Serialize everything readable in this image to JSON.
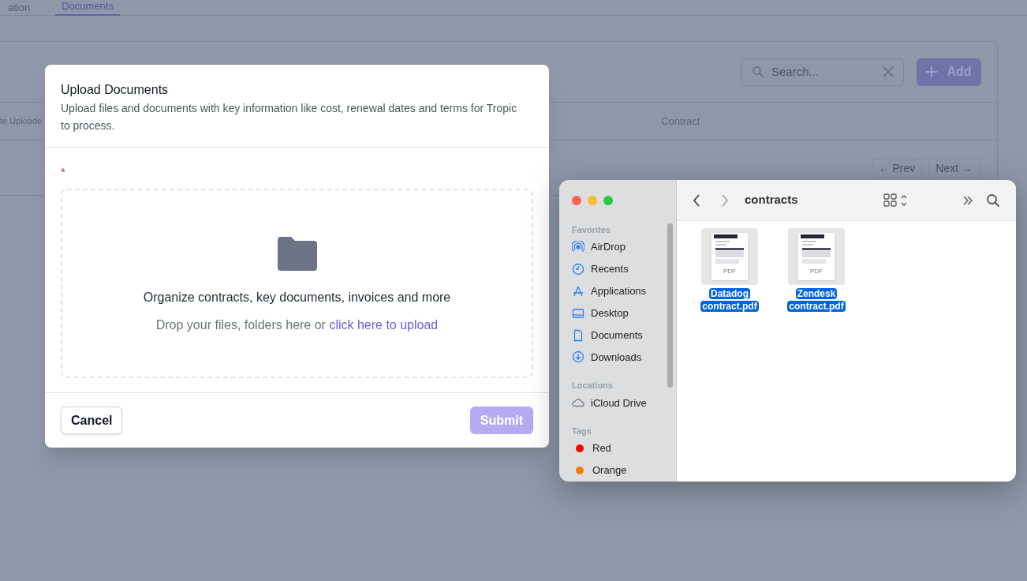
{
  "background": {
    "tabs": [
      {
        "label": "ation",
        "selected": false
      },
      {
        "label": "Documents",
        "selected": true
      }
    ],
    "search": {
      "placeholder": "Search..."
    },
    "add_button": "Add",
    "table": {
      "columns": [
        "te Uploade",
        "Contract"
      ]
    },
    "pagination": [
      "← Prev",
      "Next →"
    ]
  },
  "modal": {
    "title": "Upload Documents",
    "description": "Upload files and documents with key information like cost, renewal dates and terms for Tropic to process.",
    "required_mark": "*",
    "dropzone": {
      "heading": "Organize contracts, key documents, invoices and more",
      "hint": "Drop your files, folders here or",
      "link": "click here to upload"
    },
    "buttons": [
      {
        "label": "Cancel",
        "kind": "secondary",
        "disabled": false
      },
      {
        "label": "Submit",
        "kind": "primary",
        "disabled": true
      }
    ]
  },
  "finder": {
    "title": "contracts",
    "sidebar": [
      {
        "heading": "Favorites",
        "items": [
          {
            "label": "AirDrop",
            "kind": "airdrop"
          },
          {
            "label": "Recents",
            "kind": "clock"
          },
          {
            "label": "Applications",
            "kind": "apps"
          },
          {
            "label": "Desktop",
            "kind": "desktop"
          },
          {
            "label": "Documents",
            "kind": "document"
          },
          {
            "label": "Downloads",
            "kind": "download"
          }
        ]
      },
      {
        "heading": "Locations",
        "items": [
          {
            "label": "iCloud Drive",
            "kind": "cloud"
          }
        ]
      },
      {
        "heading": "Tags",
        "items": [
          {
            "label": "Red",
            "kind": "tag",
            "color": "#ff0000"
          },
          {
            "label": "Orange",
            "kind": "tag",
            "color": "#f57c00"
          }
        ]
      }
    ],
    "files": [
      {
        "name": "Datadog contract.pdf",
        "thumb_label": "PDF",
        "selected": true
      },
      {
        "name": "Zendesk contract.pdf",
        "thumb_label": "PDF",
        "selected": true
      }
    ]
  }
}
